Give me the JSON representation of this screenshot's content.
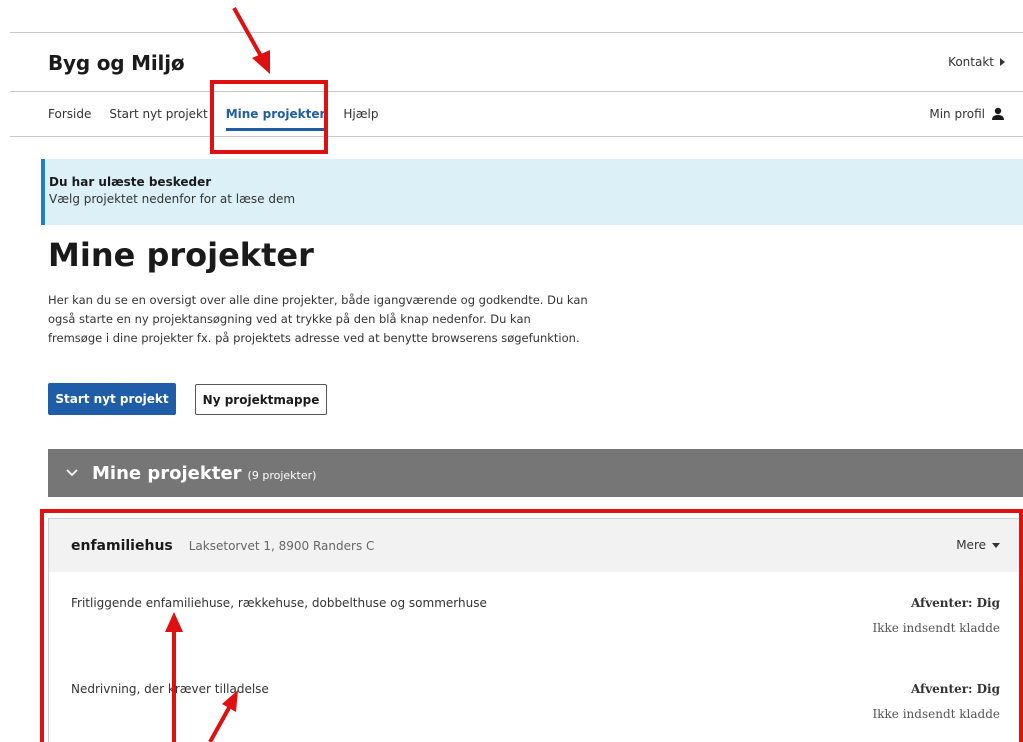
{
  "header": {
    "brand": "Byg og Miljø",
    "contact_label": "Kontakt"
  },
  "nav": {
    "items": [
      {
        "label": "Forside"
      },
      {
        "label": "Start nyt projekt"
      },
      {
        "label": "Mine projekter",
        "active": true
      },
      {
        "label": "Hjælp"
      }
    ],
    "profile_label": "Min profil"
  },
  "alert": {
    "title": "Du har ulæste beskeder",
    "text": "Vælg projektet nedenfor for at læse dem"
  },
  "main": {
    "title": "Mine projekter",
    "intro": "Her kan du se en oversigt over alle dine projekter, både igangværende og godkendte. Du kan også starte en ny projektansøgning ved at trykke på den blå knap nedenfor. Du kan fremsøge i dine projekter fx. på projektets adresse ved at benytte browserens søgefunktion.",
    "start_button": "Start nyt projekt",
    "folder_button": "Ny projektmappe"
  },
  "accordion": {
    "chevron_icon": "chevron-down-icon",
    "title": "Mine projekter",
    "count": "(9 projekter)"
  },
  "project": {
    "name": "enfamiliehus",
    "address": "Laksetorvet 1, 8900 Randers C",
    "more_label": "Mere",
    "applications": [
      {
        "description": "Fritliggende enfamiliehuse, rækkehuse, dobbelthuse og sommerhuse",
        "status": "Afventer: Dig",
        "state": "Ikke indsendt kladde"
      },
      {
        "description": "Nedrivning, der kræver tilladelse",
        "status": "Afventer: Dig",
        "state": "Ikke indsendt kladde"
      }
    ]
  },
  "colors": {
    "primary": "#1f5da8",
    "alert_bg": "#dcf0f8",
    "accordion_bg": "#767676",
    "annotation": "#e01010"
  }
}
